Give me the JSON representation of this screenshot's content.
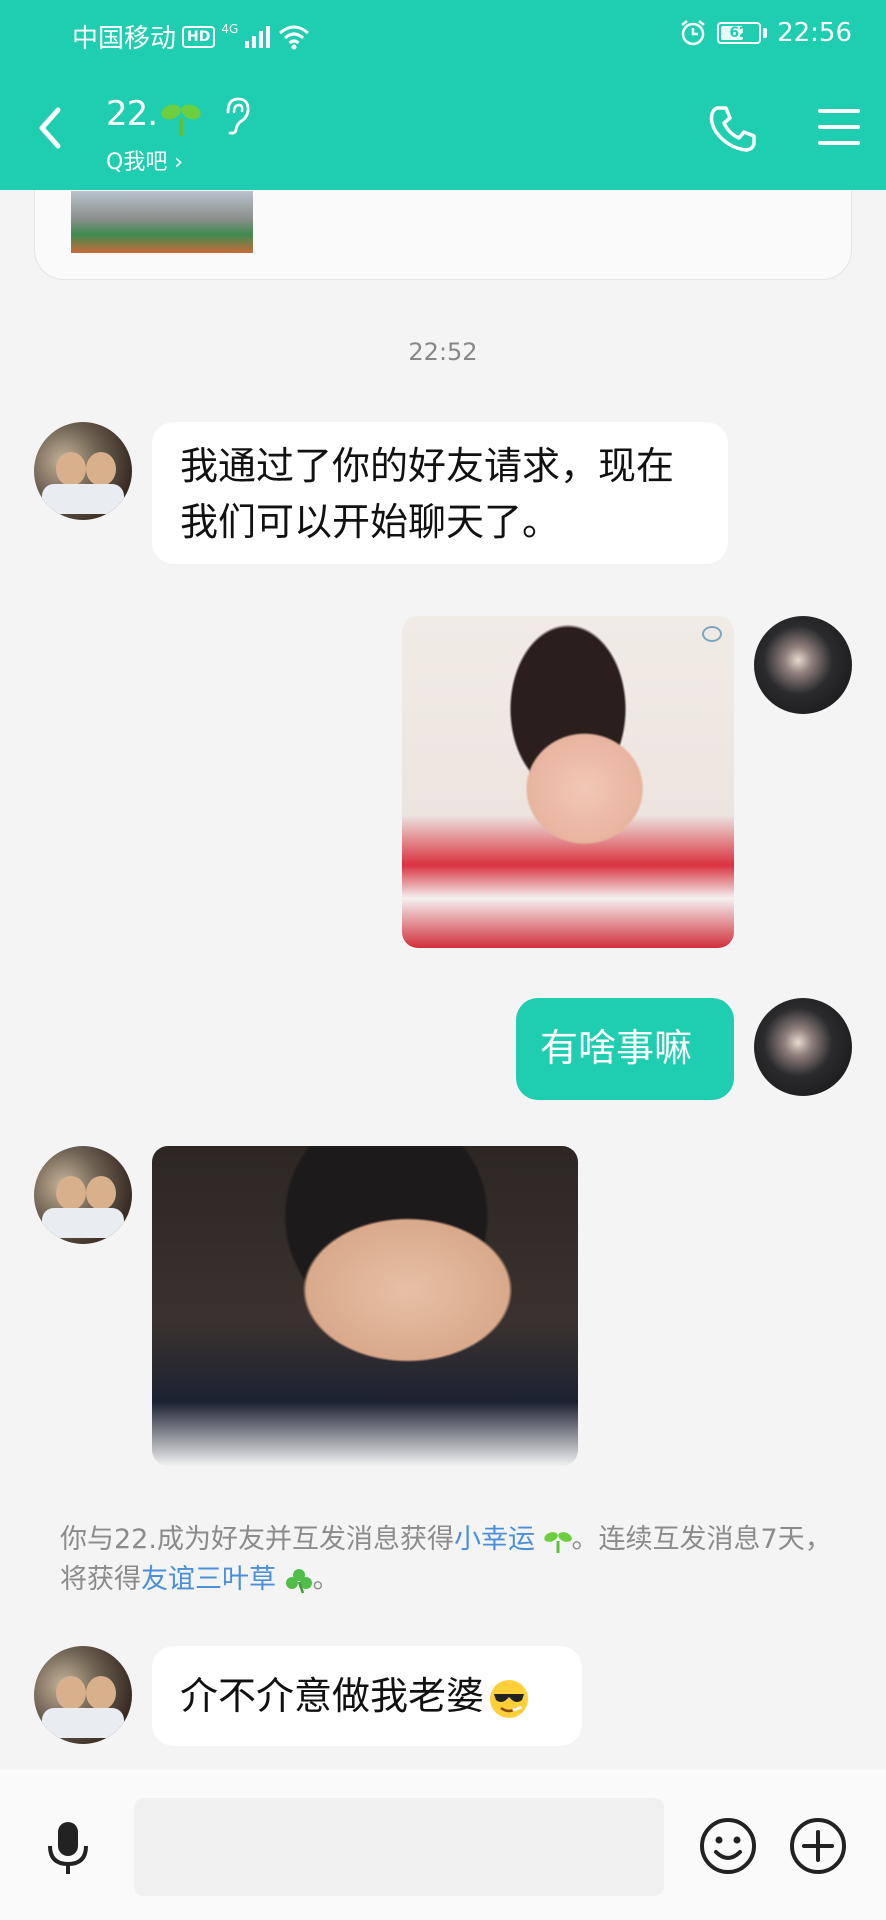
{
  "status_bar": {
    "carrier": "中国移动",
    "hd": "HD",
    "network": "4G",
    "battery": "62",
    "battery_level": 0.62,
    "time": "22:56"
  },
  "header": {
    "contact_name": "22.",
    "subtitle": "Q我吧 ›"
  },
  "chat": {
    "timestamp": "22:52",
    "messages": [
      {
        "from": "other",
        "type": "text",
        "text": "我通过了你的好友请求，现在我们可以开始聊天了。"
      },
      {
        "from": "self",
        "type": "image"
      },
      {
        "from": "self",
        "type": "text",
        "text": "有啥事嘛"
      },
      {
        "from": "other",
        "type": "image"
      },
      {
        "from": "other",
        "type": "text",
        "text": "介不介意做我老婆"
      }
    ],
    "system_note": {
      "part1": "你与22.成为好友并互发消息获得",
      "link1": "小幸运",
      "part2": "。连续互发消息7天，将获得",
      "link2": "友谊三叶草",
      "part3": "。"
    }
  },
  "input": {
    "placeholder": ""
  },
  "colors": {
    "accent": "#1fcdb0",
    "link": "#4a90d9",
    "background": "#f4f4f4"
  }
}
